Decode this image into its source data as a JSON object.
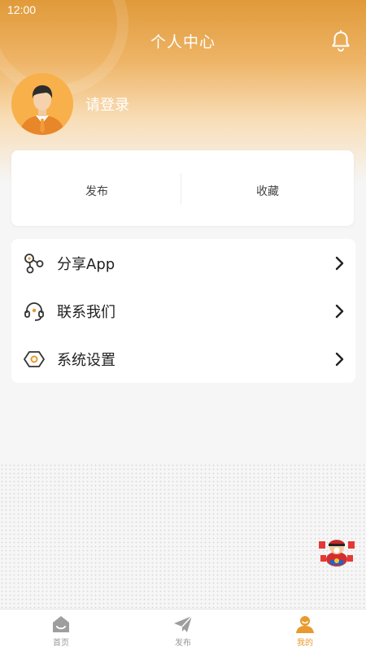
{
  "status_bar": {
    "time": "12:00"
  },
  "header": {
    "title": "个人中心",
    "notification_icon": "bell-icon"
  },
  "profile": {
    "login_prompt": "请登录",
    "avatar_icon": "default-avatar"
  },
  "stats": [
    {
      "label": "发布"
    },
    {
      "label": "收藏"
    }
  ],
  "menu": [
    {
      "label": "分享App",
      "icon": "share-icon"
    },
    {
      "label": "联系我们",
      "icon": "headset-icon"
    },
    {
      "label": "系统设置",
      "icon": "settings-icon"
    }
  ],
  "tabbar": {
    "tabs": [
      {
        "label": "首页",
        "icon": "home-icon",
        "active": false
      },
      {
        "label": "发布",
        "icon": "send-icon",
        "active": false
      },
      {
        "label": "我的",
        "icon": "user-icon",
        "active": true
      }
    ]
  },
  "colors": {
    "accent": "#e79a2e",
    "header_top": "#e09a3a",
    "inactive": "#999999"
  }
}
